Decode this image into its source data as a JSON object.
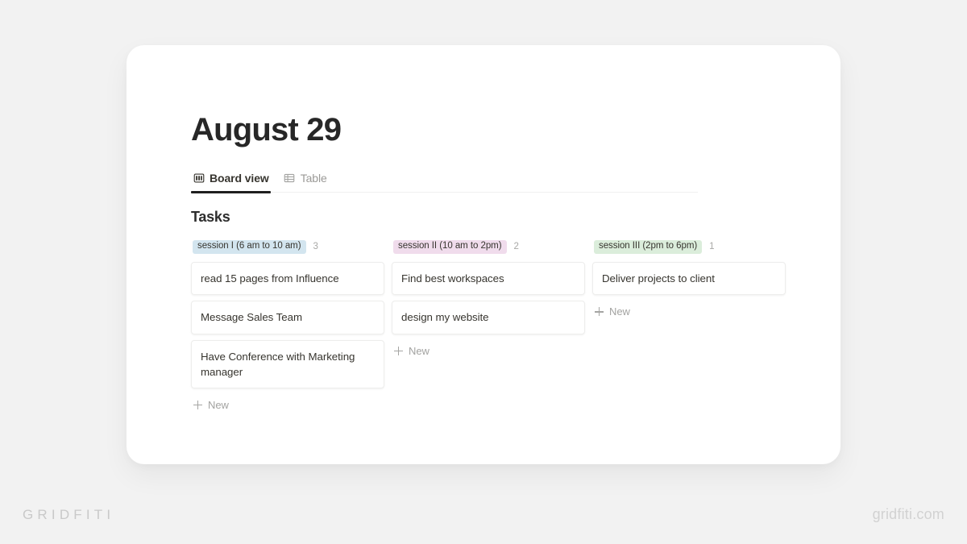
{
  "page": {
    "title": "August 29"
  },
  "tabs": [
    {
      "label": "Board view",
      "icon": "board-view-icon",
      "active": true
    },
    {
      "label": "Table",
      "icon": "table-icon",
      "active": false
    }
  ],
  "board": {
    "heading": "Tasks",
    "new_label": "New",
    "columns": [
      {
        "tag": "session I (6 am to 10 am)",
        "tag_bg": "#d3e5ef",
        "count": "3",
        "cards": [
          "read 15 pages from Influence",
          "Message Sales Team",
          "Have Conference with Marketing manager"
        ]
      },
      {
        "tag": "session II (10 am to 2pm)",
        "tag_bg": "#f0dcec",
        "count": "2",
        "cards": [
          "Find best workspaces",
          "design my website"
        ]
      },
      {
        "tag": "session III (2pm to 6pm)",
        "tag_bg": "#dbeddb",
        "count": "1",
        "cards": [
          "Deliver projects to client"
        ]
      }
    ]
  },
  "watermarks": {
    "left": "GRIDFITI",
    "right": "gridfiti.com"
  },
  "colors": {
    "background": "#f2f2f2",
    "panel": "#ffffff",
    "text": "#37352f",
    "muted": "#a3a3a1",
    "active_underline": "#1f1f1f"
  }
}
